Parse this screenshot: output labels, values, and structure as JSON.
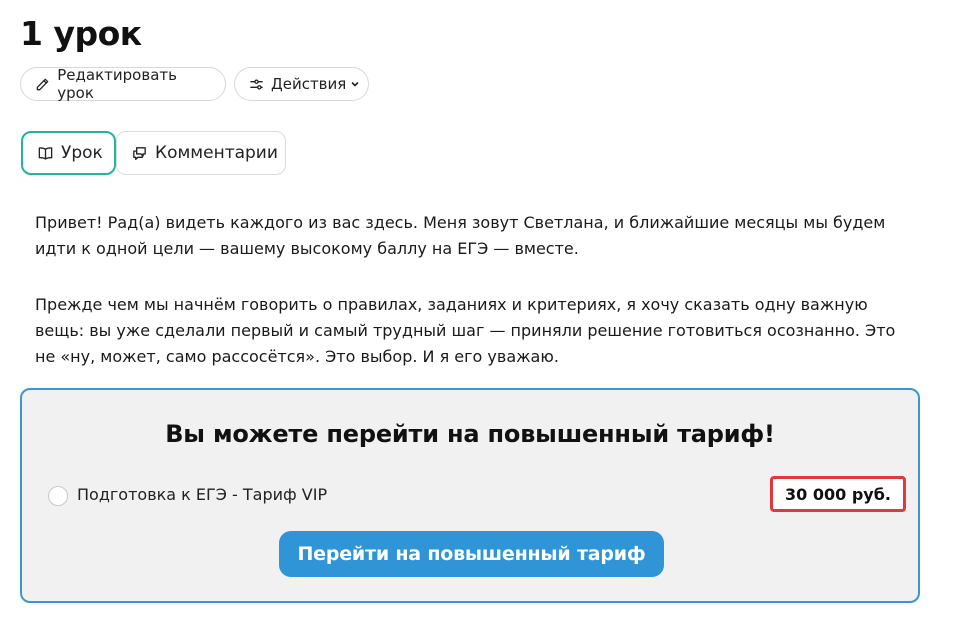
{
  "page": {
    "title": "1 урок"
  },
  "toolbar": {
    "edit_label": "Редактировать урок",
    "actions_label": "Действия"
  },
  "tabs": [
    {
      "label": "Урок",
      "active": true
    },
    {
      "label": "Комментарии",
      "active": false
    }
  ],
  "content": {
    "paragraphs": [
      "Привет! Рад(а) видеть каждого из вас здесь. Меня зовут Светлана, и ближайшие месяцы мы будем идти к одной цели — вашему высокому баллу на ЕГЭ — вместе.",
      "Прежде чем мы начнём говорить о правилах, заданиях и критериях, я хочу сказать одну важную вещь: вы уже сделали первый и самый трудный шаг — приняли решение готовиться осознанно. Это не «ну, может, само рассосётся». Это выбор. И я его уважаю."
    ]
  },
  "upsell": {
    "title": "Вы можете перейти на повышенный тариф!",
    "plan_label": "Подготовка к ЕГЭ - Тариф VIP",
    "price": "30 000 руб.",
    "button_label": "Перейти на повышенный тариф"
  },
  "colors": {
    "active_tab_border": "#22b59a",
    "upsell_border": "#3b97cf",
    "cta_background": "#2f95d6",
    "price_highlight": "#e0383b"
  }
}
